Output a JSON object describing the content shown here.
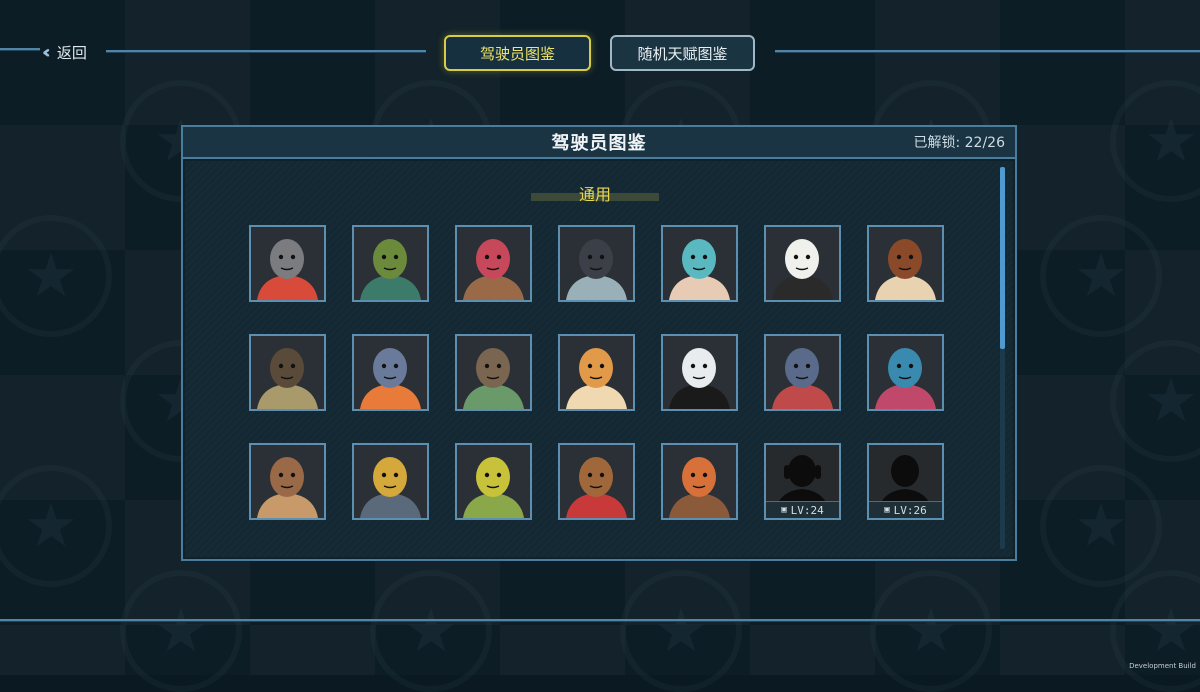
{
  "topbar": {
    "back_label": "返回",
    "tabs": [
      {
        "label": "驾驶员图鉴",
        "active": true
      },
      {
        "label": "随机天赋图鉴",
        "active": false
      }
    ]
  },
  "panel": {
    "title": "驾驶员图鉴",
    "unlock_label": "已解锁: 22/26",
    "section_title": "通用",
    "scroll_position": 0.0
  },
  "pilots": [
    {
      "icon": "cat-pilot-portrait",
      "locked": false,
      "colors": [
        "#7a7c7f",
        "#d84a3a"
      ]
    },
    {
      "icon": "plant-haired-pilot-portrait",
      "locked": false,
      "colors": [
        "#6b8a3c",
        "#3c7a6a"
      ]
    },
    {
      "icon": "red-haired-pilot-portrait",
      "locked": false,
      "colors": [
        "#c7485a",
        "#9a6a48"
      ]
    },
    {
      "icon": "hooded-masked-pilot-portrait",
      "locked": false,
      "colors": [
        "#3a3f48",
        "#9ab0b8"
      ]
    },
    {
      "icon": "teal-haired-pilot-portrait",
      "locked": false,
      "colors": [
        "#5ab8c0",
        "#e8cbb5"
      ]
    },
    {
      "icon": "panda-pilot-portrait",
      "locked": false,
      "colors": [
        "#f0f0ec",
        "#2a2a2a"
      ]
    },
    {
      "icon": "dog-pilot-portrait",
      "locked": false,
      "colors": [
        "#8a4a2a",
        "#e8d2b0"
      ]
    },
    {
      "icon": "tree-crowned-pilot-portrait",
      "locked": false,
      "colors": [
        "#5a4a3a",
        "#a89a6a"
      ]
    },
    {
      "icon": "robot-pilot-portrait",
      "locked": false,
      "colors": [
        "#6a7a9a",
        "#e87a3a"
      ]
    },
    {
      "icon": "treant-pilot-portrait",
      "locked": false,
      "colors": [
        "#7a6650",
        "#6a9a6a"
      ]
    },
    {
      "icon": "orange-cat-pilot-portrait",
      "locked": false,
      "colors": [
        "#e09a4a",
        "#f0d8b0"
      ]
    },
    {
      "icon": "white-hood-pilot-portrait",
      "locked": false,
      "colors": [
        "#e8ecef",
        "#1a1a1a"
      ]
    },
    {
      "icon": "mech-pilot-portrait",
      "locked": false,
      "colors": [
        "#5a6a8a",
        "#c04a4a"
      ]
    },
    {
      "icon": "helmet-pilot-portrait",
      "locked": false,
      "colors": [
        "#3a8ab0",
        "#c0486a"
      ]
    },
    {
      "icon": "bear-pilot-portrait",
      "locked": false,
      "colors": [
        "#9a6a48",
        "#c89a6a"
      ]
    },
    {
      "icon": "gold-robot-pilot-portrait",
      "locked": false,
      "colors": [
        "#d4a83a",
        "#5a6a7a"
      ]
    },
    {
      "icon": "yellow-dreads-pilot-portrait",
      "locked": false,
      "colors": [
        "#c8c23a",
        "#8aa84a"
      ]
    },
    {
      "icon": "cowboy-robot-pilot-portrait",
      "locked": false,
      "colors": [
        "#a0683a",
        "#c83a3a"
      ]
    },
    {
      "icon": "orange-haired-pilot-portrait",
      "locked": false,
      "colors": [
        "#d8703a",
        "#8a5a3a"
      ]
    },
    {
      "icon": "locked-silhouette-headphones",
      "locked": true,
      "lock_label": "LV:24",
      "colors": [
        "#141414",
        "#2a2a2a"
      ]
    },
    {
      "icon": "locked-silhouette",
      "locked": true,
      "lock_label": "LV:26",
      "colors": [
        "#141414",
        "#2a2a2a"
      ]
    }
  ],
  "dev_label": "Development Build"
}
